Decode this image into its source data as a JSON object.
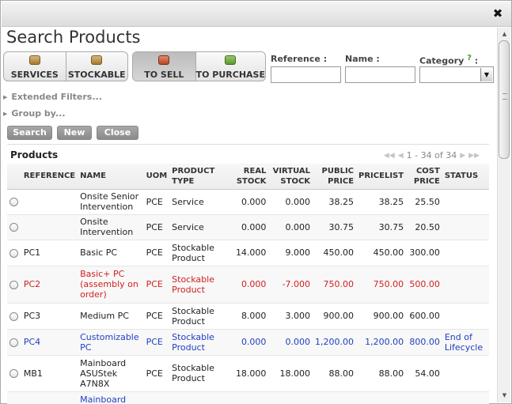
{
  "window": {
    "close_icon": "close-x-icon",
    "close_glyph": "✖"
  },
  "page": {
    "title": "Search Products"
  },
  "filters": {
    "type_buttons": [
      {
        "label": "SERVICES",
        "icon": "box-icon",
        "active": false
      },
      {
        "label": "STOCKABLE",
        "icon": "box-icon",
        "active": false
      },
      {
        "label": "TO SELL",
        "icon": "sell-icon",
        "active": true
      },
      {
        "label": "TO PURCHASE",
        "icon": "purchase-icon",
        "active": false
      }
    ],
    "reference": {
      "label": "Reference :",
      "value": ""
    },
    "name": {
      "label": "Name :",
      "value": ""
    },
    "category": {
      "label": "Category",
      "help": "?",
      "suffix": " :",
      "value": ""
    },
    "extended": "Extended Filters...",
    "groupby": "Group by..."
  },
  "actions": {
    "search": "Search",
    "new": "New",
    "close": "Close"
  },
  "list": {
    "title": "Products",
    "pager": "1 - 34 of 34",
    "columns": [
      "REFERENCE",
      "NAME",
      "UOM",
      "PRODUCT TYPE",
      "REAL STOCK",
      "VIRTUAL STOCK",
      "PUBLIC PRICE",
      "PRICELIST",
      "COST PRICE",
      "STATUS"
    ],
    "rows": [
      {
        "ref": "",
        "name": "Onsite Senior Intervention",
        "uom": "PCE",
        "type": "Service",
        "real": "0.000",
        "virtual": "0.000",
        "public": "38.25",
        "pricelist": "38.25",
        "cost": "25.50",
        "status": "",
        "color": ""
      },
      {
        "ref": "",
        "name": "Onsite Intervention",
        "uom": "PCE",
        "type": "Service",
        "real": "0.000",
        "virtual": "0.000",
        "public": "30.75",
        "pricelist": "30.75",
        "cost": "20.50",
        "status": "",
        "color": ""
      },
      {
        "ref": "PC1",
        "name": "Basic PC",
        "uom": "PCE",
        "type": "Stockable Product",
        "real": "14.000",
        "virtual": "9.000",
        "public": "450.00",
        "pricelist": "450.00",
        "cost": "300.00",
        "status": "",
        "color": ""
      },
      {
        "ref": "PC2",
        "name": "Basic+ PC (assembly on order)",
        "uom": "PCE",
        "type": "Stockable Product",
        "real": "0.000",
        "virtual": "-7.000",
        "public": "750.00",
        "pricelist": "750.00",
        "cost": "500.00",
        "status": "",
        "color": "red"
      },
      {
        "ref": "PC3",
        "name": "Medium PC",
        "uom": "PCE",
        "type": "Stockable Product",
        "real": "8.000",
        "virtual": "3.000",
        "public": "900.00",
        "pricelist": "900.00",
        "cost": "600.00",
        "status": "",
        "color": ""
      },
      {
        "ref": "PC4",
        "name": "Customizable PC",
        "uom": "PCE",
        "type": "Stockable Product",
        "real": "0.000",
        "virtual": "0.000",
        "public": "1,200.00",
        "pricelist": "1,200.00",
        "cost": "800.00",
        "status": "End of Lifecycle",
        "color": "blue"
      },
      {
        "ref": "MB1",
        "name": "Mainboard ASUStek A7N8X",
        "uom": "PCE",
        "type": "Stockable Product",
        "real": "18.000",
        "virtual": "18.000",
        "public": "88.00",
        "pricelist": "88.00",
        "cost": "54.00",
        "status": "",
        "color": ""
      },
      {
        "ref": "",
        "name": "Mainboard",
        "uom": "",
        "type": "",
        "real": "",
        "virtual": "",
        "public": "",
        "pricelist": "",
        "cost": "",
        "status": "",
        "color": "blue"
      }
    ]
  }
}
